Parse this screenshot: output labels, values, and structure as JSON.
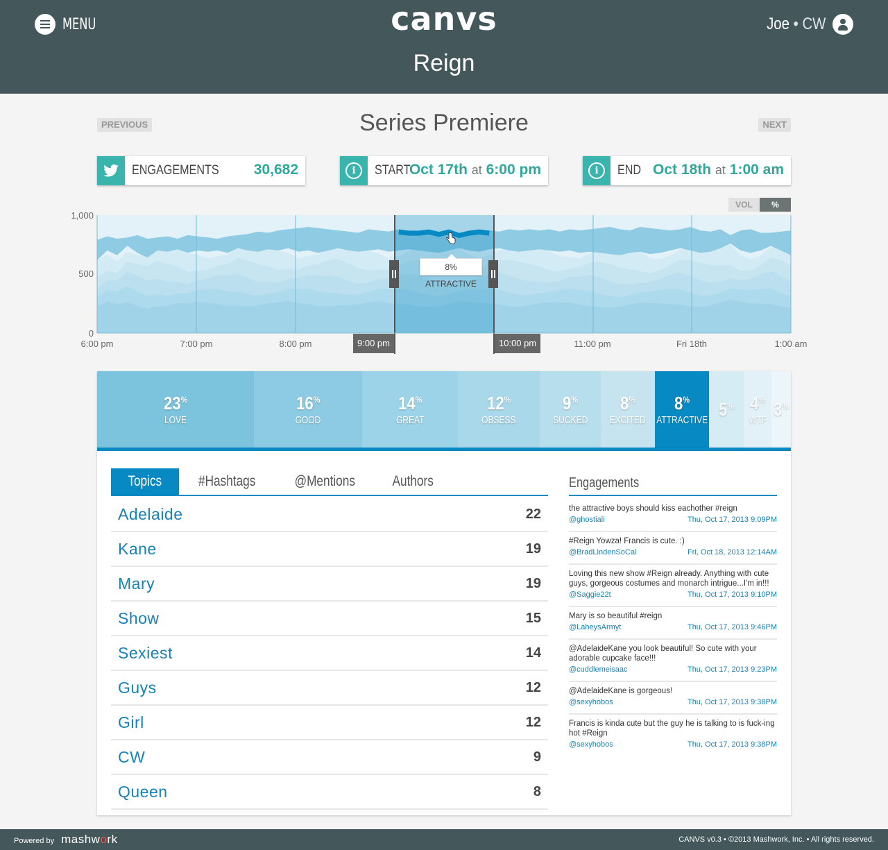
{
  "header": {
    "menu_label": "MENU",
    "logo": "canvs",
    "user_name": "Joe",
    "user_network": "CW",
    "show_title": "Reign"
  },
  "episode": {
    "previous_label": "PREVIOUS",
    "next_label": "NEXT",
    "title": "Series Premiere"
  },
  "cards": {
    "engagements": {
      "label": "ENGAGEMENTS",
      "value": "30,682"
    },
    "start": {
      "label": "START",
      "date": "Oct 17th",
      "at": "at",
      "time": "6:00 pm"
    },
    "end": {
      "label": "END",
      "date": "Oct 18th",
      "at": "at",
      "time": "1:00 am"
    }
  },
  "chart_toggle": {
    "vol_label": "VOL",
    "pct_label": "%"
  },
  "chart_data": {
    "type": "area",
    "x_ticks": [
      "6:00 pm",
      "7:00 pm",
      "8:00 pm",
      "9:00 pm",
      "10:00 pm",
      "11:00 pm",
      "Fri 18th",
      "1:00 am"
    ],
    "y_ticks": [
      "1,000",
      "500",
      "0"
    ],
    "ylim": [
      0,
      1000
    ],
    "selection": {
      "start_label": "9:00 pm",
      "end_label": "10:00 pm"
    },
    "tooltip": "8% ATTRACTIVE",
    "top_boundary": [
      620,
      700,
      660,
      740,
      680,
      640,
      700,
      690,
      710,
      680,
      700,
      690,
      700,
      680,
      720,
      700,
      690,
      710,
      700,
      720,
      690,
      700,
      680,
      700,
      720,
      700,
      690,
      700,
      710,
      690,
      700,
      710,
      700,
      690,
      680,
      700,
      720,
      700,
      690,
      710,
      720,
      700,
      690,
      700,
      710,
      700,
      690,
      700,
      680,
      690,
      680,
      670,
      660,
      680,
      690,
      670,
      680,
      700,
      720,
      700,
      680,
      690,
      720,
      760,
      700,
      680,
      700,
      740,
      700,
      660
    ],
    "upper_line": [
      790,
      820,
      800,
      810,
      830,
      800,
      810,
      820,
      800,
      830,
      820,
      810,
      800,
      820,
      830,
      840,
      860,
      850,
      870,
      880,
      890,
      900,
      890,
      880,
      870,
      860,
      850,
      880,
      870,
      860,
      880,
      870,
      870,
      880,
      860,
      880,
      850,
      870,
      880,
      870,
      860,
      880,
      870,
      880,
      870,
      880,
      860,
      880,
      870,
      880,
      890,
      900,
      880,
      870,
      900,
      890,
      880,
      870,
      880,
      900,
      870,
      860,
      880,
      830,
      870,
      880,
      850,
      850,
      860,
      870
    ]
  },
  "sentiments": [
    {
      "pct": "23",
      "label": "LOVE",
      "color": "#7cc4de"
    },
    {
      "pct": "16",
      "label": "GOOD",
      "color": "#8ccbe3"
    },
    {
      "pct": "14",
      "label": "GREAT",
      "color": "#9dd3e8"
    },
    {
      "pct": "12",
      "label": "OBSESS",
      "color": "#a9d8ea"
    },
    {
      "pct": "9",
      "label": "SUCKED",
      "color": "#b7deed"
    },
    {
      "pct": "8",
      "label": "EXCITED",
      "color": "#c6e4f0"
    },
    {
      "pct": "8",
      "label": "ATTRACTIVE",
      "color": "#0789c3"
    },
    {
      "pct": "5",
      "label": "",
      "color": "#d6ecf5"
    },
    {
      "pct": "4",
      "label": "WTF",
      "color": "#e2f1f8"
    },
    {
      "pct": "3",
      "label": "",
      "color": "#ecf6fa"
    }
  ],
  "tabs": [
    {
      "label": "Topics",
      "active": true
    },
    {
      "label": "#Hashtags",
      "active": false
    },
    {
      "label": "@Mentions",
      "active": false
    },
    {
      "label": "Authors",
      "active": false
    }
  ],
  "topics": [
    {
      "name": "Adelaide",
      "count": "22"
    },
    {
      "name": "Kane",
      "count": "19"
    },
    {
      "name": "Mary",
      "count": "19"
    },
    {
      "name": "Show",
      "count": "15"
    },
    {
      "name": "Sexiest",
      "count": "14"
    },
    {
      "name": "Guys",
      "count": "12"
    },
    {
      "name": "Girl",
      "count": "12"
    },
    {
      "name": "CW",
      "count": "9"
    },
    {
      "name": "Queen",
      "count": "8"
    }
  ],
  "engagements_panel": {
    "title": "Engagements",
    "items": [
      {
        "text": "the attractive boys should kiss eachother #reign",
        "author": "@ghostiali",
        "time": "Thu, Oct 17, 2013 9:09PM"
      },
      {
        "text": "#Reign Yowza! Francis is cute. :)",
        "author": "@BradLindenSoCal",
        "time": "Fri, Oct 18, 2013 12:14AM"
      },
      {
        "text": "Loving this new show #Reign already. Anything with cute guys, gorgeous costumes and monarch intrigue...I'm in!!!",
        "author": "@Saggie22t",
        "time": "Thu, Oct 17, 2013 9:10PM"
      },
      {
        "text": "Mary is so beautiful #reign",
        "author": "@LaheysArmyt",
        "time": "Thu, Oct 17, 2013 9:46PM"
      },
      {
        "text": "@AdelaideKane you look beautiful! So cute with your adorable cupcake face!!!",
        "author": "@cuddlemeisaac",
        "time": "Thu, Oct 17, 2013 9:23PM"
      },
      {
        "text": "@AdelaideKane is gorgeous!",
        "author": "@sexyhobos",
        "time": "Thu, Oct 17, 2013 9:38PM"
      },
      {
        "text": "Francis is kinda cute but the guy he is talking to is fuck-ing hot #Reign",
        "author": "@sexyhobos",
        "time": "Thu, Oct 17, 2013 9:38PM"
      }
    ]
  },
  "footer": {
    "powered_by": "Powered by",
    "brand_a": "mashw",
    "brand_o": "o",
    "brand_b": "rk",
    "copyright": "CANVS v0.3  •  ©2013 Mashwork, Inc.  •  All rights reserved."
  }
}
